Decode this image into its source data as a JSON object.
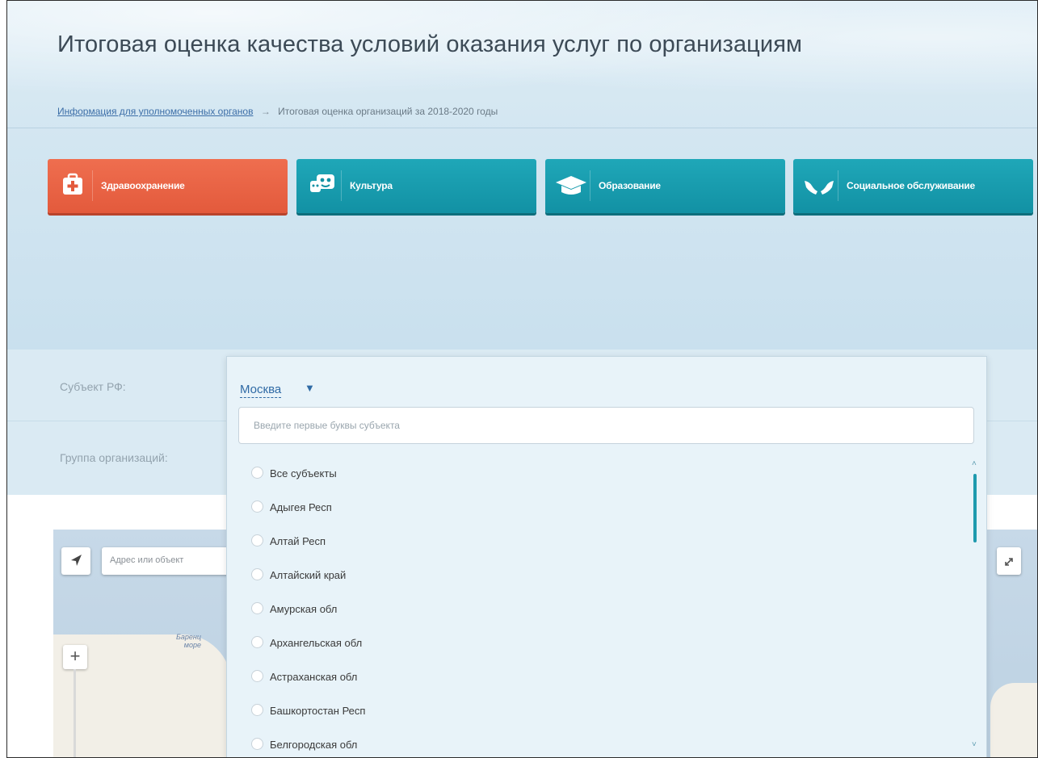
{
  "header": {
    "title": "Итоговая оценка качества условий оказания услуг по организациям",
    "breadcrumb_link": "Информация для уполномоченных органов",
    "breadcrumb_sep": "→",
    "breadcrumb_current": "Итоговая оценка организаций за 2018-2020 годы"
  },
  "categories": [
    {
      "label": "Здравоохранение",
      "icon": "first-aid-icon",
      "active": true
    },
    {
      "label": "Культура",
      "icon": "theater-icon",
      "active": false
    },
    {
      "label": "Образование",
      "icon": "graduation-cap-icon",
      "active": false
    },
    {
      "label": "Социальное обслуживание",
      "icon": "hands-icon",
      "active": false
    }
  ],
  "filters": {
    "subject_label": "Субъект РФ:",
    "group_label": "Группа организаций:"
  },
  "dropdown": {
    "selected": "Москва",
    "arrow": "▼",
    "search_placeholder": "Введите первые буквы субъекта",
    "items": [
      "Все субъекты",
      "Адыгея Респ",
      "Алтай Респ",
      "Алтайский край",
      "Амурская обл",
      "Архангельская обл",
      "Астраханская обл",
      "Башкортостан Респ",
      "Белгородская обл"
    ],
    "scroll_up": "˄",
    "scroll_down": "˅"
  },
  "map": {
    "search_placeholder": "Адрес или объект",
    "sea_label_1": "Баренц",
    "sea_label_2": "море",
    "zoom_in": "+",
    "colors": {
      "water": "#c7d9e8",
      "land": "#f2efe7"
    }
  },
  "colors": {
    "accent_active": "#e35a3c",
    "accent_tab": "#1291a4",
    "link": "#2f6aa5"
  }
}
